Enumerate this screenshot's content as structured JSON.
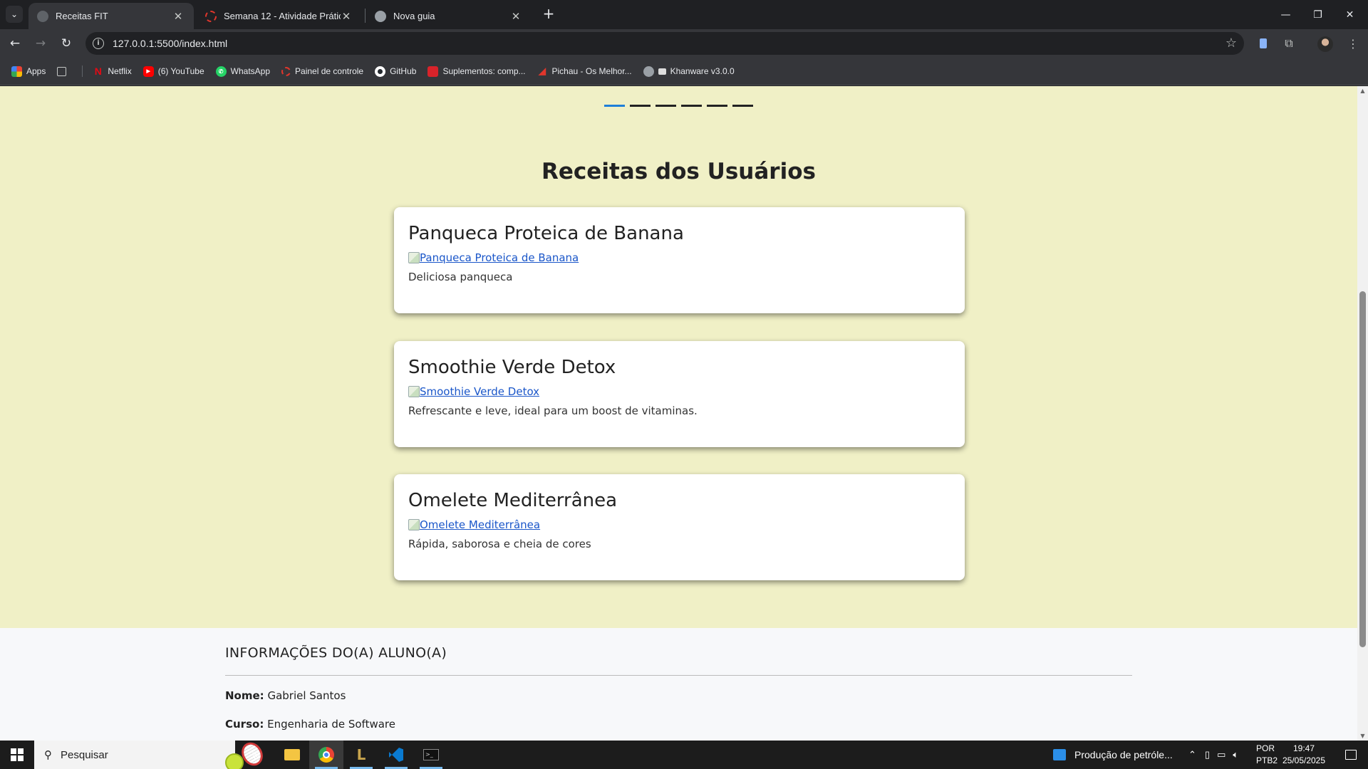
{
  "browser": {
    "tabs": [
      {
        "label": "Receitas FIT",
        "active": true,
        "icon": "globe-icon"
      },
      {
        "label": "Semana 12 - Atividade Prática",
        "active": false,
        "icon": "ring-icon"
      },
      {
        "label": "Nova guia",
        "active": false,
        "icon": "chrome-icon"
      }
    ],
    "url": "127.0.0.1:5500/index.html",
    "bookmarks": [
      {
        "label": "Apps",
        "icon": "apps-grid-icon"
      },
      {
        "label": "Netflix",
        "icon": "netflix-icon"
      },
      {
        "label": "(6) YouTube",
        "icon": "youtube-icon"
      },
      {
        "label": "WhatsApp",
        "icon": "whatsapp-icon"
      },
      {
        "label": "Painel de controle",
        "icon": "ring-icon"
      },
      {
        "label": "GitHub",
        "icon": "github-icon"
      },
      {
        "label": "Suplementos: comp...",
        "icon": "supplement-icon"
      },
      {
        "label": "Pichau - Os Melhor...",
        "icon": "pichau-icon"
      },
      {
        "label": "Khanware v3.0.0",
        "icon": "globe-icon"
      }
    ]
  },
  "page": {
    "carousel": {
      "indicator_count": 6,
      "active_index": 0
    },
    "section_title": "Receitas dos Usuários",
    "recipes": [
      {
        "title": "Panqueca Proteica de Banana",
        "image_alt": "Panqueca Proteica de Banana",
        "description": "Deliciosa panqueca"
      },
      {
        "title": "Smoothie Verde Detox",
        "image_alt": "Smoothie Verde Detox",
        "description": "Refrescante e leve, ideal para um boost de vitaminas."
      },
      {
        "title": "Omelete Mediterrânea",
        "image_alt": "Omelete Mediterrânea",
        "description": "Rápida, saborosa e cheia de cores"
      }
    ],
    "student_info": {
      "heading": "INFORMAÇÕES DO(A) ALUNO(A)",
      "name_label": "Nome:",
      "name_value": "Gabriel Santos",
      "course_label": "Curso:",
      "course_value": "Engenharia de Software"
    },
    "colors": {
      "background": "#f0f0c6",
      "link": "#1a56c9",
      "indicator_active": "#1e7fd9"
    }
  },
  "taskbar": {
    "search_placeholder": "Pesquisar",
    "news_text": "Produção de petróle...",
    "language": "POR",
    "keyboard": "PTB2",
    "time": "19:47",
    "date": "25/05/2025"
  }
}
